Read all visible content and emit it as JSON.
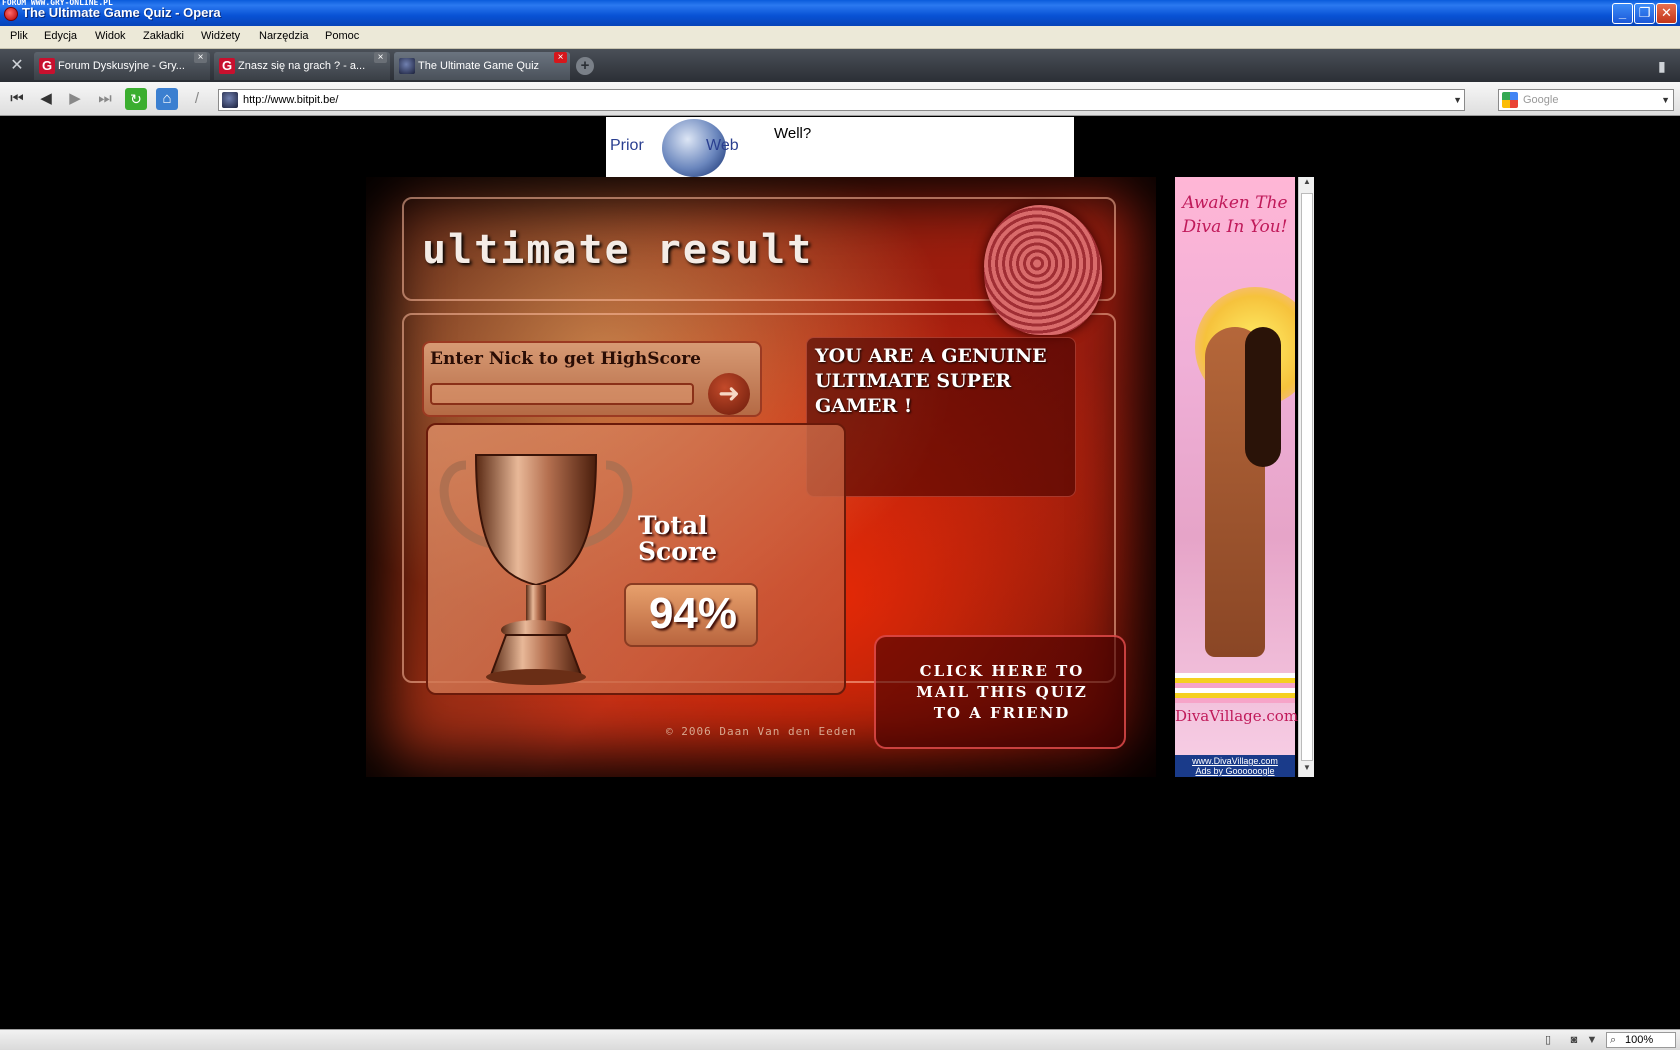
{
  "window": {
    "watermark": "FORUM WWW.GRY-ONLINE.PL",
    "title": "The Ultimate Game Quiz - Opera",
    "minimize": "_",
    "restore": "❐",
    "close": "✕"
  },
  "menu": {
    "items": [
      "Plik",
      "Edycja",
      "Widok",
      "Zakładki",
      "Widżety",
      "Narzędzia",
      "Pomoc"
    ]
  },
  "tabs": [
    {
      "label": "Forum Dyskusyjne - Gry...",
      "favicon": "G"
    },
    {
      "label": "Znasz się na grach ? - a...",
      "favicon": "G"
    },
    {
      "label": "The Ultimate Game Quiz",
      "favicon": ""
    }
  ],
  "icons": {
    "tools": "✕",
    "newtab": "+",
    "trash": "🗑",
    "rewind": "⏮",
    "back": "◀",
    "forward": "▶",
    "fastforward": "⏭",
    "reload": "↻",
    "home": "⌂",
    "edit": "/",
    "dropdown": "▼"
  },
  "address": {
    "url": "http://www.bitpit.be/"
  },
  "search": {
    "placeholder": "Google"
  },
  "banner": {
    "logo_prior": "Prior",
    "logo_web": "Web",
    "text": "Well?"
  },
  "quiz": {
    "title": "ultimate result",
    "nick_label": "Enter Nick to get HighScore",
    "submit_arrow": "➜",
    "message": "YOU ARE A GENUINE ULTIMATE SUPER GAMER !",
    "total_label_1": "Total",
    "total_label_2": "Score",
    "score": "94%",
    "mail_line_1": "CLICK HERE TO",
    "mail_line_2": "MAIL THIS QUIZ",
    "mail_line_3": "TO A FRIEND",
    "copyright": "© 2006 Daan Van den Eeden"
  },
  "ad": {
    "headline_1": "Awaken The",
    "headline_2": "Diva In You!",
    "site": "DivaVillage.com",
    "link": "www.DivaVillage.com",
    "by": "Ads by Goooooogle"
  },
  "status": {
    "zoom": "100%"
  },
  "colors": {
    "titlebar": "#0852d5",
    "tabbar": "#3a3f46",
    "active_tab_close": "#d6171c",
    "ad_accent": "#c01a5a"
  }
}
